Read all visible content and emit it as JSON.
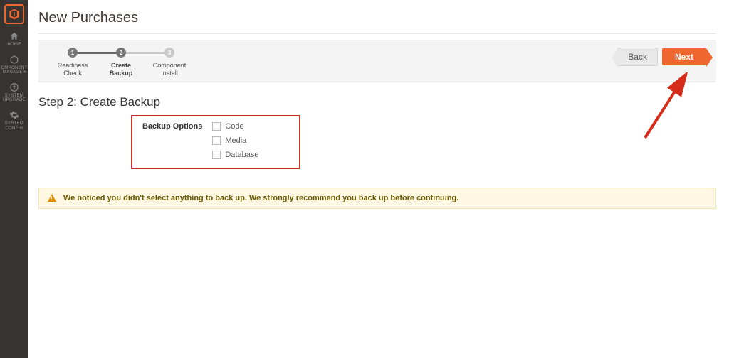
{
  "sidebar": {
    "items": [
      {
        "label": "HOME",
        "icon": "home"
      },
      {
        "label": "OMPONENT\nMANAGER",
        "icon": "cube"
      },
      {
        "label": "SYSTEM\nUPGRADE",
        "icon": "arrow-circle"
      },
      {
        "label": "SYSTEM\nCONFIG",
        "icon": "gear"
      }
    ]
  },
  "page_title": "New Purchases",
  "steps": [
    {
      "num": "1",
      "label": "Readiness\nCheck",
      "state": "done"
    },
    {
      "num": "2",
      "label": "Create\nBackup",
      "state": "active"
    },
    {
      "num": "3",
      "label": "Component\nInstall",
      "state": "inactive"
    }
  ],
  "buttons": {
    "back": "Back",
    "next": "Next"
  },
  "section_title": "Step 2: Create Backup",
  "backup": {
    "group_label": "Backup Options",
    "options": [
      {
        "label": "Code"
      },
      {
        "label": "Media"
      },
      {
        "label": "Database"
      }
    ]
  },
  "warning_text": "We noticed you didn't select anything to back up. We strongly recommend you back up before continuing.",
  "colors": {
    "accent": "#ef672f",
    "warn_bg": "#fdf7e3",
    "highlight_border": "#c0392b"
  }
}
